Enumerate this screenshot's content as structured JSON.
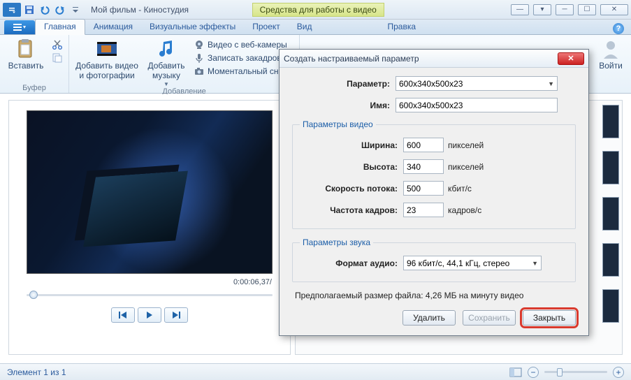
{
  "titlebar": {
    "title": "Мой фильм - Киностудия",
    "contextTab": "Средства для работы с видео"
  },
  "tabs": {
    "main": "Главная",
    "animation": "Анимация",
    "effects": "Визуальные эффекты",
    "project": "Проект",
    "view": "Вид",
    "edit": "Правка"
  },
  "ribbon": {
    "paste": "Вставить",
    "bufferGroup": "Буфер",
    "addMedia": "Добавить видео и фотографии",
    "addMusic": "Добавить музыку",
    "webcam": "Видео с веб-камеры",
    "recordVoice": "Записать закадровый",
    "snapshot": "Моментальный снимо",
    "addGroup": "Добавление",
    "signIn": "Войти"
  },
  "preview": {
    "time": "0:00:06,37/"
  },
  "status": {
    "left": "Элемент 1 из 1"
  },
  "dialog": {
    "title": "Создать настраиваемый параметр",
    "paramLabel": "Параметр:",
    "paramValue": "600x340x500x23",
    "nameLabel": "Имя:",
    "nameValue": "600x340x500x23",
    "videoLegend": "Параметры видео",
    "widthLabel": "Ширина:",
    "widthValue": "600",
    "widthUnit": "пикселей",
    "heightLabel": "Высота:",
    "heightValue": "340",
    "heightUnit": "пикселей",
    "bitrateLabel": "Скорость потока:",
    "bitrateValue": "500",
    "bitrateUnit": "кбит/с",
    "fpsLabel": "Частота кадров:",
    "fpsValue": "23",
    "fpsUnit": "кадров/с",
    "audioLegend": "Параметры звука",
    "audioLabel": "Формат аудио:",
    "audioValue": "96 кбит/с, 44,1 кГц, стерео",
    "estimate": "Предполагаемый размер файла: 4,26 МБ на минуту видео",
    "delete": "Удалить",
    "save": "Сохранить",
    "close": "Закрыть"
  }
}
